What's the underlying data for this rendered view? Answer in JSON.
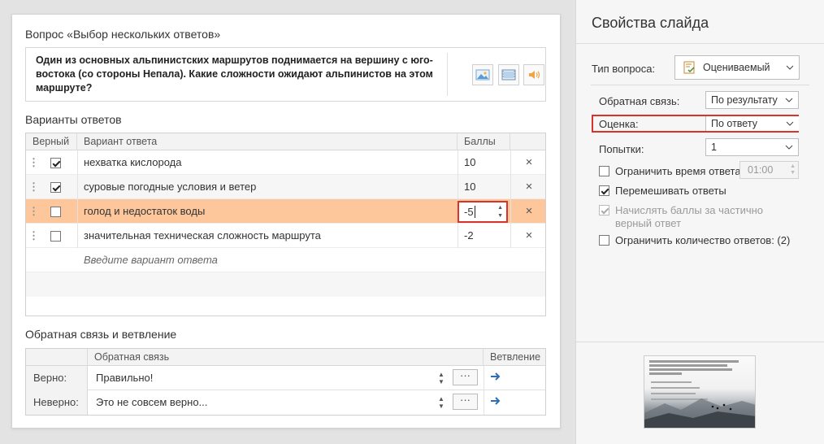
{
  "question": {
    "title": "Вопрос «Выбор нескольких ответов»",
    "text": "Один из основных альпинистских маршрутов поднимается на вершину с юго-востока (со стороны Непала). Какие сложности ожидают альпинистов на этом маршруте?",
    "media_buttons": [
      "image-icon",
      "video-icon",
      "audio-icon"
    ]
  },
  "answers": {
    "title": "Варианты ответов",
    "headers": {
      "correct": "Верный",
      "variant": "Вариант ответа",
      "points": "Баллы"
    },
    "rows": [
      {
        "correct": true,
        "text": "нехватка кислорода",
        "points": "10"
      },
      {
        "correct": true,
        "text": "суровые погодные условия и ветер",
        "points": "10"
      },
      {
        "correct": false,
        "text": "голод и недостаток воды",
        "points": "-5",
        "selected": true
      },
      {
        "correct": false,
        "text": "значительная техническая сложность маршрута",
        "points": "-2"
      }
    ],
    "placeholder": "Введите вариант ответа",
    "delete_glyph": "×"
  },
  "feedback": {
    "title": "Обратная связь и ветвление",
    "headers": {
      "feedback": "Обратная связь",
      "branching": "Ветвление"
    },
    "rows": [
      {
        "label": "Верно:",
        "text": "Правильно!",
        "more": "···"
      },
      {
        "label": "Неверно:",
        "text": "Это не совсем верно...",
        "more": "···"
      }
    ]
  },
  "panel": {
    "title": "Свойства слайда",
    "question_type_label": "Тип вопроса:",
    "question_type_value": "Оцениваемый",
    "feedback_label": "Обратная связь:",
    "feedback_value": "По результату",
    "score_label": "Оценка:",
    "score_value": "По ответу",
    "attempts_label": "Попытки:",
    "attempts_value": "1",
    "limit_time_label": "Ограничить время ответа:",
    "limit_time_value": "01:00",
    "shuffle_label": "Перемешивать ответы",
    "partial_label": "Начислять баллы за частично верный ответ",
    "limit_count_label": "Ограничить количество ответов: (2)",
    "checks": {
      "limit_time": false,
      "shuffle": true,
      "partial": true,
      "limit_count": false
    }
  },
  "colors": {
    "selected_row": "#fdc79b",
    "highlight_border": "#d9342b",
    "accent_arrow": "#2f6eb5"
  }
}
